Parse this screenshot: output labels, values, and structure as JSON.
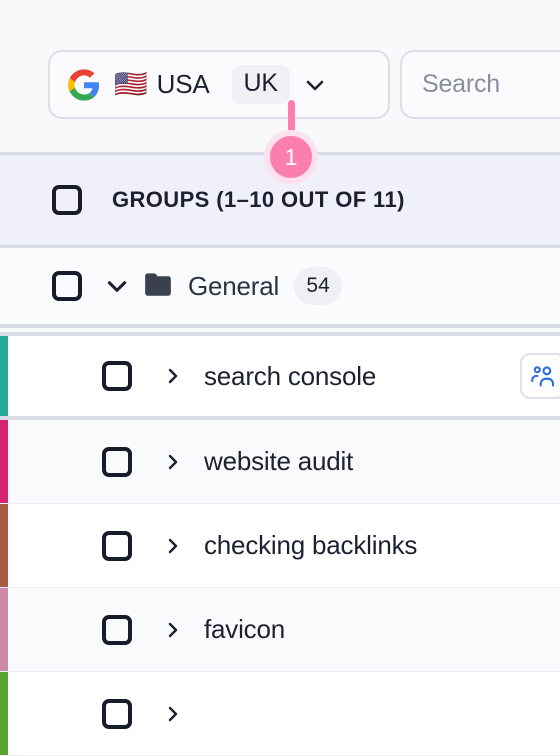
{
  "topbar": {
    "google_icon": "google-logo-icon",
    "flag": "🇺🇸",
    "country": "USA",
    "region_chip": "UK",
    "chevron_icon": "chevron-down-icon",
    "search_placeholder": "Search",
    "search_icon": "search-icon"
  },
  "callout": {
    "number": "1",
    "color": "#fb7eae",
    "ring_color": "#fde1ec"
  },
  "groups_header": {
    "checkbox_checked": false,
    "title": "GROUPS  (1–10 OUT OF 11)"
  },
  "folder": {
    "checkbox_checked": false,
    "caret_icon": "chevron-down-icon",
    "folder_icon": "folder-icon",
    "name": "General",
    "count": "54"
  },
  "keywords": [
    {
      "label": "search console",
      "color": "#29a99a",
      "checked": false,
      "caret_icon": "chevron-right-icon",
      "selected": true,
      "shade": "white",
      "badge_icon": "people-group-icon"
    },
    {
      "label": "website audit",
      "color": "#d6256e",
      "checked": false,
      "caret_icon": "chevron-right-icon",
      "selected": false,
      "shade": "shaded",
      "badge_icon": ""
    },
    {
      "label": "checking backlinks",
      "color": "#a85b44",
      "checked": false,
      "caret_icon": "chevron-right-icon",
      "selected": false,
      "shade": "white",
      "badge_icon": ""
    },
    {
      "label": "favicon",
      "color": "#cc8aa6",
      "checked": false,
      "caret_icon": "chevron-right-icon",
      "selected": false,
      "shade": "shaded",
      "badge_icon": ""
    },
    {
      "label": "",
      "color": "#5aa52b",
      "checked": false,
      "caret_icon": "chevron-right-icon",
      "selected": false,
      "shade": "white",
      "badge_icon": ""
    }
  ],
  "colors": {
    "page_bg": "#f8f9fb",
    "band_bg": "#f0f0fa",
    "border": "#d9dce8",
    "text": "#1c2030",
    "muted": "#8a8f9e",
    "accent_blue": "#2d6fdb"
  }
}
